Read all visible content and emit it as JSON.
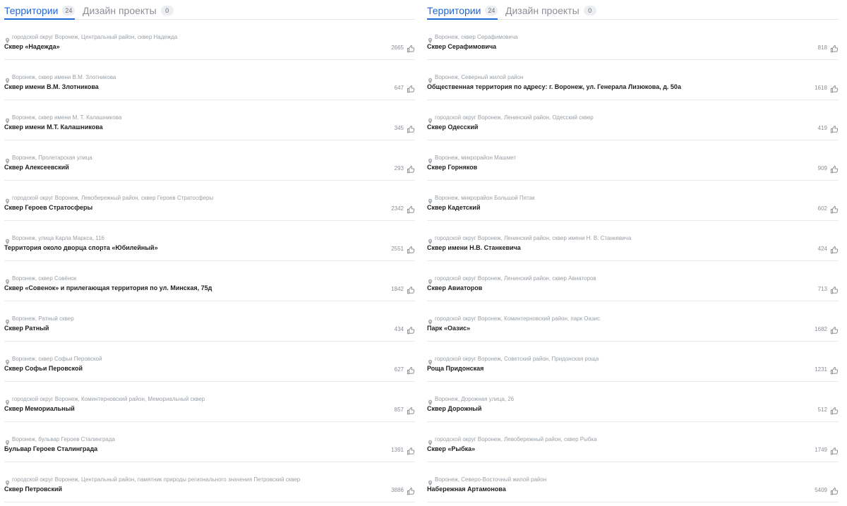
{
  "left": {
    "tabs": [
      {
        "label": "Территории",
        "count": "24",
        "active": true
      },
      {
        "label": "Дизайн проекты",
        "count": "0",
        "active": false
      }
    ],
    "items": [
      {
        "address": "городской округ Воронеж, Центральный район, сквер Надежда",
        "title": "Сквер «Надежда»",
        "likes": "2665"
      },
      {
        "address": "Воронеж, сквер имени В.М. Злотникова",
        "title": "Сквер имени В.М. Злотникова",
        "likes": "647"
      },
      {
        "address": "Воронеж, сквер имени М. Т. Калашникова",
        "title": "Сквер имени М.Т. Калашникова",
        "likes": "345"
      },
      {
        "address": "Воронеж, Пролетарская улица",
        "title": "Сквер Алексеевский",
        "likes": "293"
      },
      {
        "address": "городской округ Воронеж, Левобережный район, сквер Героев Стратосферы",
        "title": "Сквер Героев Стратосферы",
        "likes": "2342"
      },
      {
        "address": "Воронеж, улица Карла Маркса, 116",
        "title": "Территория около дворца спорта «Юбилейный»",
        "likes": "2551"
      },
      {
        "address": "Воронеж, сквер Совёнок",
        "title": "Сквер «Совенок» и прилегающая территория по ул. Минская, 75д",
        "likes": "1842"
      },
      {
        "address": "Воронеж, Ратный сквер",
        "title": "Сквер Ратный",
        "likes": "434"
      },
      {
        "address": "Воронеж, сквер Софьи Перовской",
        "title": "Сквер Софьи Перовской",
        "likes": "627"
      },
      {
        "address": "городской округ Воронеж, Коминтерновский район, Мемориальный сквер",
        "title": "Сквер Мемориальный",
        "likes": "857"
      },
      {
        "address": "Воронеж, бульвар Героев Сталинграда",
        "title": "Бульвар Героев Сталинграда",
        "likes": "1391"
      },
      {
        "address": "городской округ Воронеж, Центральный район, памятник природы регионального значения Петровский сквер",
        "title": "Сквер Петровский",
        "likes": "3886"
      }
    ]
  },
  "right": {
    "tabs": [
      {
        "label": "Территории",
        "count": "24",
        "active": true
      },
      {
        "label": "Дизайн проекты",
        "count": "0",
        "active": false
      }
    ],
    "items": [
      {
        "address": "Воронеж, сквер Серафимовича",
        "title": "Сквер Серафимовича",
        "likes": "818"
      },
      {
        "address": "Воронеж, Северный жилой район",
        "title": "Общественная территория по адресу: г. Воронеж, ул. Генерала Лизюкова, д. 50а",
        "likes": "1618"
      },
      {
        "address": "городской округ Воронеж, Ленинский район, Одесский сквер",
        "title": "Сквер Одесский",
        "likes": "419"
      },
      {
        "address": "Воронеж, микрорайон Машмет",
        "title": "Сквер Горняков",
        "likes": "909"
      },
      {
        "address": "Воронеж, микрорайон Большой Пятак",
        "title": "Сквер Кадетский",
        "likes": "602"
      },
      {
        "address": "городской округ Воронеж, Ленинский район, сквер имени Н. В. Станкевича",
        "title": "Сквер имени Н.В. Станкевича",
        "likes": "424"
      },
      {
        "address": "городской округ Воронеж, Ленинский район, сквер Авиаторов",
        "title": "Сквер Авиаторов",
        "likes": "713"
      },
      {
        "address": "городской округ Воронеж, Коминтерновский район, парк Оазис",
        "title": "Парк «Оазис»",
        "likes": "1682"
      },
      {
        "address": "городской округ Воронеж, Советский район, Придонская роща",
        "title": "Роща Придонская",
        "likes": "1231"
      },
      {
        "address": "Воронеж, Дорожная улица, 26",
        "title": "Сквер Дорожный",
        "likes": "512"
      },
      {
        "address": "городской округ Воронеж, Левобережный район, сквер Рыбка",
        "title": "Сквер «Рыбка»",
        "likes": "1749"
      },
      {
        "address": "Воронеж, Северо-Восточный жилой район",
        "title": "Набережная Артамонова",
        "likes": "5409"
      }
    ]
  },
  "colors": {
    "accent": "#1f66d6",
    "muted": "#9aa0a6",
    "divider": "#e9e9e9"
  },
  "icons": {
    "location": "map-pin-icon",
    "like": "thumbs-up-icon"
  }
}
